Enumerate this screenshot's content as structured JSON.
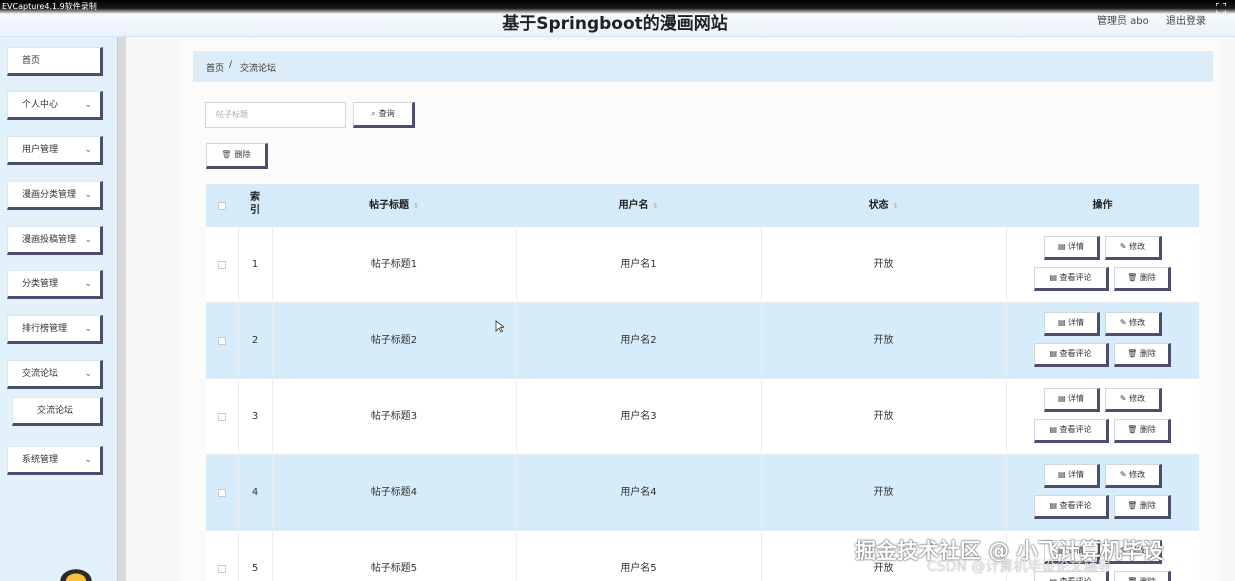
{
  "recorder_label": "EVCapture4.1.9软件录制",
  "header": {
    "title": "基于Springboot的漫画网站",
    "admin": "管理员 abo",
    "logout": "退出登录"
  },
  "sidebar": {
    "items": [
      {
        "label": "首页"
      },
      {
        "label": "个人中心"
      },
      {
        "label": "用户管理"
      },
      {
        "label": "漫画分类管理"
      },
      {
        "label": "漫画投稿管理"
      },
      {
        "label": "分类管理"
      },
      {
        "label": "排行榜管理"
      },
      {
        "label": "交流论坛"
      },
      {
        "label": "交流论坛"
      },
      {
        "label": "系统管理"
      }
    ]
  },
  "breadcrumb": {
    "home": "首页",
    "sep": "/",
    "current": "交流论坛"
  },
  "search": {
    "placeholder": "帖子标题",
    "button": "查询"
  },
  "toolbar": {
    "delete": "删除"
  },
  "table": {
    "headers": {
      "index": "索\n引",
      "title": "帖子标题",
      "username": "用户名",
      "status": "状态",
      "actions": "操作"
    },
    "rows": [
      {
        "index": "1",
        "title": "帖子标题1",
        "username": "用户名1",
        "status": "开放"
      },
      {
        "index": "2",
        "title": "帖子标题2",
        "username": "用户名2",
        "status": "开放"
      },
      {
        "index": "3",
        "title": "帖子标题3",
        "username": "用户名3",
        "status": "开放"
      },
      {
        "index": "4",
        "title": "帖子标题4",
        "username": "用户名4",
        "status": "开放"
      },
      {
        "index": "5",
        "title": "帖子标题5",
        "username": "用户名5",
        "status": "开放"
      }
    ],
    "actions": {
      "detail": "详情",
      "edit": "修改",
      "comments": "查看评论",
      "delete": "删除"
    }
  },
  "watermark": {
    "line1": "掘金技术社区 @ 小飞计算机毕设",
    "line2": "CSDN @计算机毕设论文辅导"
  },
  "colors": {
    "accent_border": "#4b4e6d",
    "header_bg": "#d5ebfa",
    "row_alt": "#d6ecfa",
    "sidebar_bg": "#e3f1fb"
  }
}
